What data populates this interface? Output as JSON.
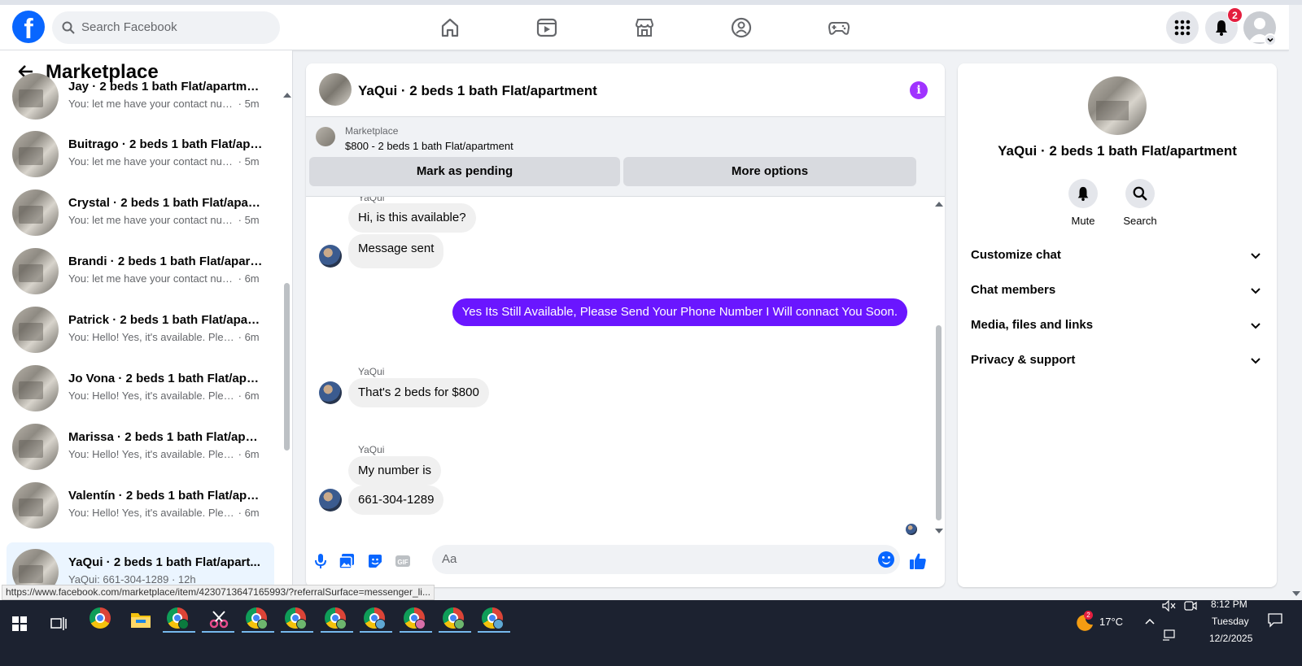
{
  "topbar": {
    "search_placeholder": "Search Facebook",
    "notification_count": "2",
    "logo_letter": "f",
    "nav_icons": [
      "home-icon",
      "video-icon",
      "marketplace-icon",
      "groups-icon",
      "gaming-icon"
    ]
  },
  "sidebar": {
    "title": "Marketplace",
    "conversations": [
      {
        "name": "Jay · 2 beds 1 bath Flat/apartment",
        "preview": "You: let me have your contact num...",
        "time": "· 5m"
      },
      {
        "name": "Buitrago · 2 beds 1 bath Flat/apa...",
        "preview": "You: let me have your contact num...",
        "time": "· 5m"
      },
      {
        "name": "Crystal · 2 beds 1 bath Flat/apart...",
        "preview": "You: let me have your contact num...",
        "time": "· 5m"
      },
      {
        "name": "Brandi · 2 beds 1 bath Flat/apart...",
        "preview": "You: let me have your contact num...",
        "time": "· 6m"
      },
      {
        "name": "Patrick · 2 beds 1 bath Flat/apart...",
        "preview": "You: Hello! Yes, it's available. Pleas...",
        "time": "· 6m"
      },
      {
        "name": "Jo Vona · 2 beds 1 bath Flat/apar...",
        "preview": "You: Hello! Yes, it's available. Pleas...",
        "time": "· 6m"
      },
      {
        "name": "Marissa · 2 beds 1 bath Flat/apar...",
        "preview": "You: Hello! Yes, it's available. Pleas...",
        "time": "· 6m"
      },
      {
        "name": "Valentín · 2 beds 1 bath Flat/apa...",
        "preview": "You: Hello! Yes, it's available. Pleas...",
        "time": "· 6m"
      },
      {
        "name": "YaQui · 2 beds 1 bath Flat/apart...",
        "preview": "YaQui: 661-304-1289",
        "time": "· 12h"
      }
    ]
  },
  "chat": {
    "title": "YaQui · 2 beds 1 bath Flat/apartment",
    "listing_source": "Marketplace",
    "listing_price": "$800 - 2 beds 1 bath Flat/apartment",
    "mark_pending_label": "Mark as pending",
    "more_options_label": "More options",
    "sender_name": "YaQui",
    "messages": [
      {
        "text": "Hi, is this available?"
      },
      {
        "text": "Message sent"
      },
      {
        "text": "Yes Its Still Available, Please Send Your Phone Number I Will connact You Soon."
      },
      {
        "text": "That's 2 beds for $800"
      },
      {
        "text": "My number is"
      },
      {
        "text": "661-304-1289"
      }
    ],
    "composer_placeholder": "Aa"
  },
  "details": {
    "name": "YaQui · 2 beds 1 bath Flat/apartment",
    "mute_label": "Mute",
    "search_label": "Search",
    "sections": [
      "Customize chat",
      "Chat members",
      "Media, files and links",
      "Privacy & support"
    ]
  },
  "status_url": "https://www.facebook.com/marketplace/item/4230713647165993/?referralSurface=messenger_li...",
  "taskbar": {
    "weather_temp": "17°C",
    "weather_badge": "2",
    "time": "8:12 PM",
    "day": "Tuesday",
    "date": "12/2/2025"
  }
}
